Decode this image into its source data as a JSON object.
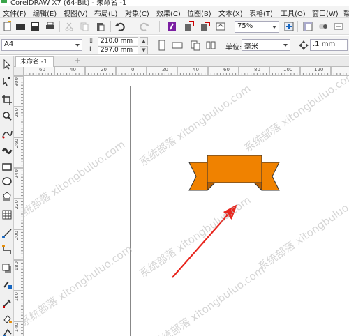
{
  "window": {
    "title": "CorelDRAW X7 (64-Bit) - 未命名 -1"
  },
  "menu": [
    "文件(F)",
    "编辑(E)",
    "视图(V)",
    "布局(L)",
    "对象(C)",
    "效果(C)",
    "位图(B)",
    "文本(X)",
    "表格(T)",
    "工具(O)",
    "窗口(W)",
    "帮"
  ],
  "toolbar": {
    "zoom": "75%"
  },
  "property_bar": {
    "page_size": "A4",
    "width": "210.0 mm",
    "height": "297.0 mm",
    "units_label": "单位:",
    "units": "毫米",
    "nudge": ".1 mm"
  },
  "document": {
    "tab": "未命名 -1",
    "add_tab": "+"
  },
  "ruler": {
    "h_labels": [
      "60",
      "40",
      "20",
      "0",
      "20",
      "40",
      "60",
      "80",
      "100",
      "120"
    ],
    "v_labels": [
      "300",
      "280",
      "260",
      "240",
      "220",
      "200",
      "180",
      "160",
      "140"
    ]
  },
  "watermark": "系统部落 xitongbuluo.com",
  "colors": {
    "ribbon_fill": "#f08200",
    "ribbon_stroke": "#333333",
    "arrow": "#e8261e"
  }
}
